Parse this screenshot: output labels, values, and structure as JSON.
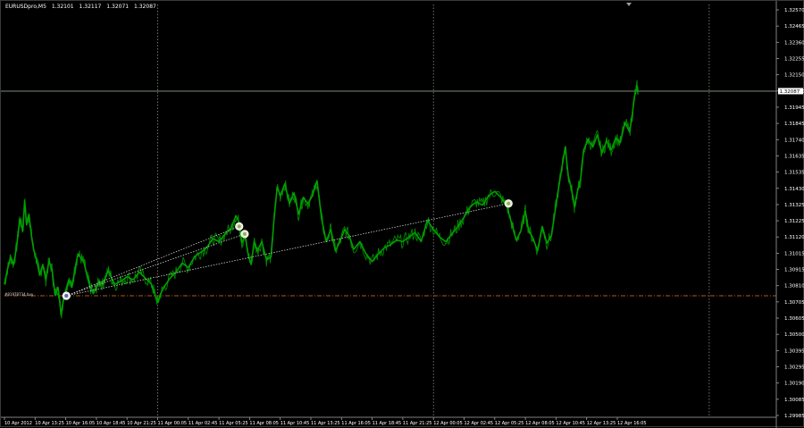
{
  "header": {
    "symbol": "EURUSDpro,M5",
    "open": "1.32101",
    "high": "1.32117",
    "low": "1.32071",
    "close": "1.32087"
  },
  "price_axis": {
    "ticks": [
      "1.32570",
      "1.32465",
      "1.32360",
      "1.32255",
      "1.32150",
      "1.32050",
      "1.31945",
      "1.31845",
      "1.31740",
      "1.31635",
      "1.31535",
      "1.31430",
      "1.31325",
      "1.31225",
      "1.31120",
      "1.31015",
      "1.30915",
      "1.30810",
      "1.30705",
      "1.30605",
      "1.30500",
      "1.30395",
      "1.30295",
      "1.30190",
      "1.30085",
      "1.29985"
    ],
    "current_price": "1.32087"
  },
  "time_axis": {
    "ticks": [
      "10 Apr 2012",
      "10 Apr 13:25",
      "10 Apr 16:05",
      "10 Apr 18:45",
      "10 Apr 21:25",
      "11 Apr 00:05",
      "11 Apr 02:45",
      "11 Apr 05:25",
      "11 Apr 08:05",
      "11 Apr 10:45",
      "11 Apr 13:25",
      "11 Apr 16:05",
      "11 Apr 18:45",
      "11 Apr 21:25",
      "12 Apr 00:05",
      "12 Apr 02:45",
      "12 Apr 05:25",
      "12 Apr 08:05",
      "12 Apr 10:45",
      "12 Apr 13:25",
      "12 Apr 16:05"
    ]
  },
  "order_line": {
    "label": "#81978734 buy",
    "price": 1.30745
  },
  "colors": {
    "background": "#000000",
    "price_line": "#00a000",
    "grid": "#a0a0a0",
    "axis_text": "#ffffff",
    "order_line": "#b05a1a",
    "trade_line": "#d0d0d0",
    "current_price_bg": "#ffffff",
    "current_price_text": "#000000",
    "current_price_line": "#7a8a7a"
  },
  "chart_data": {
    "type": "line",
    "symbol": "EURUSDpro,M5",
    "ylim": [
      1.2996,
      1.3262
    ],
    "x_range": [
      0,
      20.7
    ],
    "x_unit": "time-axis label index",
    "grid": true,
    "vertical_separators_at_label_index": [
      5,
      14,
      23
    ],
    "series": [
      {
        "name": "EURUSDpro,M5",
        "points": [
          [
            0.0,
            1.3082
          ],
          [
            0.1,
            1.3092
          ],
          [
            0.2,
            1.31
          ],
          [
            0.3,
            1.3095
          ],
          [
            0.4,
            1.3107
          ],
          [
            0.5,
            1.3125
          ],
          [
            0.6,
            1.3117
          ],
          [
            0.66,
            1.3137
          ],
          [
            0.72,
            1.3121
          ],
          [
            0.8,
            1.3128
          ],
          [
            0.88,
            1.3114
          ],
          [
            0.95,
            1.3105
          ],
          [
            1.05,
            1.3098
          ],
          [
            1.15,
            1.3088
          ],
          [
            1.25,
            1.3095
          ],
          [
            1.35,
            1.3085
          ],
          [
            1.45,
            1.3097
          ],
          [
            1.55,
            1.3092
          ],
          [
            1.65,
            1.3075
          ],
          [
            1.75,
            1.308
          ],
          [
            1.85,
            1.3062
          ],
          [
            1.92,
            1.3072
          ],
          [
            2.0,
            1.3078
          ],
          [
            2.1,
            1.3085
          ],
          [
            2.2,
            1.308
          ],
          [
            2.3,
            1.3092
          ],
          [
            2.4,
            1.3102
          ],
          [
            2.5,
            1.3099
          ],
          [
            2.6,
            1.3096
          ],
          [
            2.7,
            1.3087
          ],
          [
            2.8,
            1.308
          ],
          [
            2.9,
            1.3076
          ],
          [
            3.0,
            1.308
          ],
          [
            3.1,
            1.3084
          ],
          [
            3.2,
            1.3082
          ],
          [
            3.3,
            1.3087
          ],
          [
            3.4,
            1.3091
          ],
          [
            3.5,
            1.3086
          ],
          [
            3.6,
            1.3082
          ],
          [
            3.8,
            1.3084
          ],
          [
            4.0,
            1.3087
          ],
          [
            4.2,
            1.3085
          ],
          [
            4.4,
            1.309
          ],
          [
            4.6,
            1.3086
          ],
          [
            4.8,
            1.3082
          ],
          [
            4.9,
            1.3076
          ],
          [
            5.0,
            1.307
          ],
          [
            5.1,
            1.3076
          ],
          [
            5.2,
            1.308
          ],
          [
            5.4,
            1.3086
          ],
          [
            5.6,
            1.309
          ],
          [
            5.8,
            1.3096
          ],
          [
            6.0,
            1.3093
          ],
          [
            6.2,
            1.31
          ],
          [
            6.4,
            1.3103
          ],
          [
            6.6,
            1.3106
          ],
          [
            6.8,
            1.3112
          ],
          [
            7.0,
            1.311
          ],
          [
            7.2,
            1.3115
          ],
          [
            7.4,
            1.3119
          ],
          [
            7.55,
            1.3127
          ],
          [
            7.65,
            1.3123
          ],
          [
            7.75,
            1.3109
          ],
          [
            7.85,
            1.3114
          ],
          [
            7.95,
            1.3102
          ],
          [
            8.05,
            1.3095
          ],
          [
            8.15,
            1.311
          ],
          [
            8.25,
            1.3104
          ],
          [
            8.4,
            1.311
          ],
          [
            8.55,
            1.3098
          ],
          [
            8.7,
            1.31
          ],
          [
            8.8,
            1.3125
          ],
          [
            8.9,
            1.3146
          ],
          [
            9.0,
            1.314
          ],
          [
            9.15,
            1.3148
          ],
          [
            9.3,
            1.3135
          ],
          [
            9.45,
            1.3142
          ],
          [
            9.6,
            1.3128
          ],
          [
            9.75,
            1.3139
          ],
          [
            9.9,
            1.3135
          ],
          [
            10.05,
            1.314
          ],
          [
            10.2,
            1.315
          ],
          [
            10.35,
            1.3125
          ],
          [
            10.5,
            1.311
          ],
          [
            10.65,
            1.3118
          ],
          [
            10.8,
            1.3104
          ],
          [
            10.95,
            1.311
          ],
          [
            11.1,
            1.3118
          ],
          [
            11.25,
            1.3114
          ],
          [
            11.4,
            1.3105
          ],
          [
            11.6,
            1.311
          ],
          [
            11.8,
            1.3102
          ],
          [
            12.0,
            1.3097
          ],
          [
            12.2,
            1.3102
          ],
          [
            12.4,
            1.3106
          ],
          [
            12.6,
            1.3108
          ],
          [
            12.8,
            1.3111
          ],
          [
            13.0,
            1.311
          ],
          [
            13.2,
            1.3113
          ],
          [
            13.4,
            1.3116
          ],
          [
            13.6,
            1.311
          ],
          [
            13.8,
            1.3124
          ],
          [
            14.0,
            1.3118
          ],
          [
            14.2,
            1.3113
          ],
          [
            14.4,
            1.311
          ],
          [
            14.6,
            1.3115
          ],
          [
            14.8,
            1.312
          ],
          [
            15.0,
            1.3126
          ],
          [
            15.2,
            1.3133
          ],
          [
            15.4,
            1.3136
          ],
          [
            15.6,
            1.3134
          ],
          [
            15.8,
            1.314
          ],
          [
            16.0,
            1.3143
          ],
          [
            16.2,
            1.3139
          ],
          [
            16.4,
            1.3133
          ],
          [
            16.55,
            1.3122
          ],
          [
            16.7,
            1.3111
          ],
          [
            16.85,
            1.3117
          ],
          [
            17.0,
            1.313
          ],
          [
            17.1,
            1.3118
          ],
          [
            17.25,
            1.3112
          ],
          [
            17.4,
            1.3104
          ],
          [
            17.55,
            1.312
          ],
          [
            17.7,
            1.3109
          ],
          [
            17.85,
            1.3114
          ],
          [
            18.0,
            1.3134
          ],
          [
            18.1,
            1.3147
          ],
          [
            18.2,
            1.316
          ],
          [
            18.3,
            1.3172
          ],
          [
            18.4,
            1.3153
          ],
          [
            18.5,
            1.3145
          ],
          [
            18.6,
            1.3133
          ],
          [
            18.7,
            1.3143
          ],
          [
            18.8,
            1.315
          ],
          [
            18.9,
            1.317
          ],
          [
            19.05,
            1.3177
          ],
          [
            19.2,
            1.3172
          ],
          [
            19.35,
            1.318
          ],
          [
            19.5,
            1.3168
          ],
          [
            19.65,
            1.3176
          ],
          [
            19.8,
            1.317
          ],
          [
            19.95,
            1.3178
          ],
          [
            20.1,
            1.3175
          ],
          [
            20.25,
            1.3188
          ],
          [
            20.4,
            1.3182
          ],
          [
            20.48,
            1.3192
          ],
          [
            20.56,
            1.3205
          ],
          [
            20.64,
            1.3212
          ],
          [
            20.68,
            1.3208
          ]
        ]
      }
    ],
    "trades": [
      {
        "open": [
          2.02,
          1.30745
        ],
        "close": [
          7.66,
          1.312
        ]
      },
      {
        "open": [
          2.02,
          1.30745
        ],
        "close": [
          7.84,
          1.3115
        ]
      },
      {
        "open": [
          2.02,
          1.30745
        ],
        "close": [
          16.45,
          1.3135
        ]
      }
    ]
  }
}
